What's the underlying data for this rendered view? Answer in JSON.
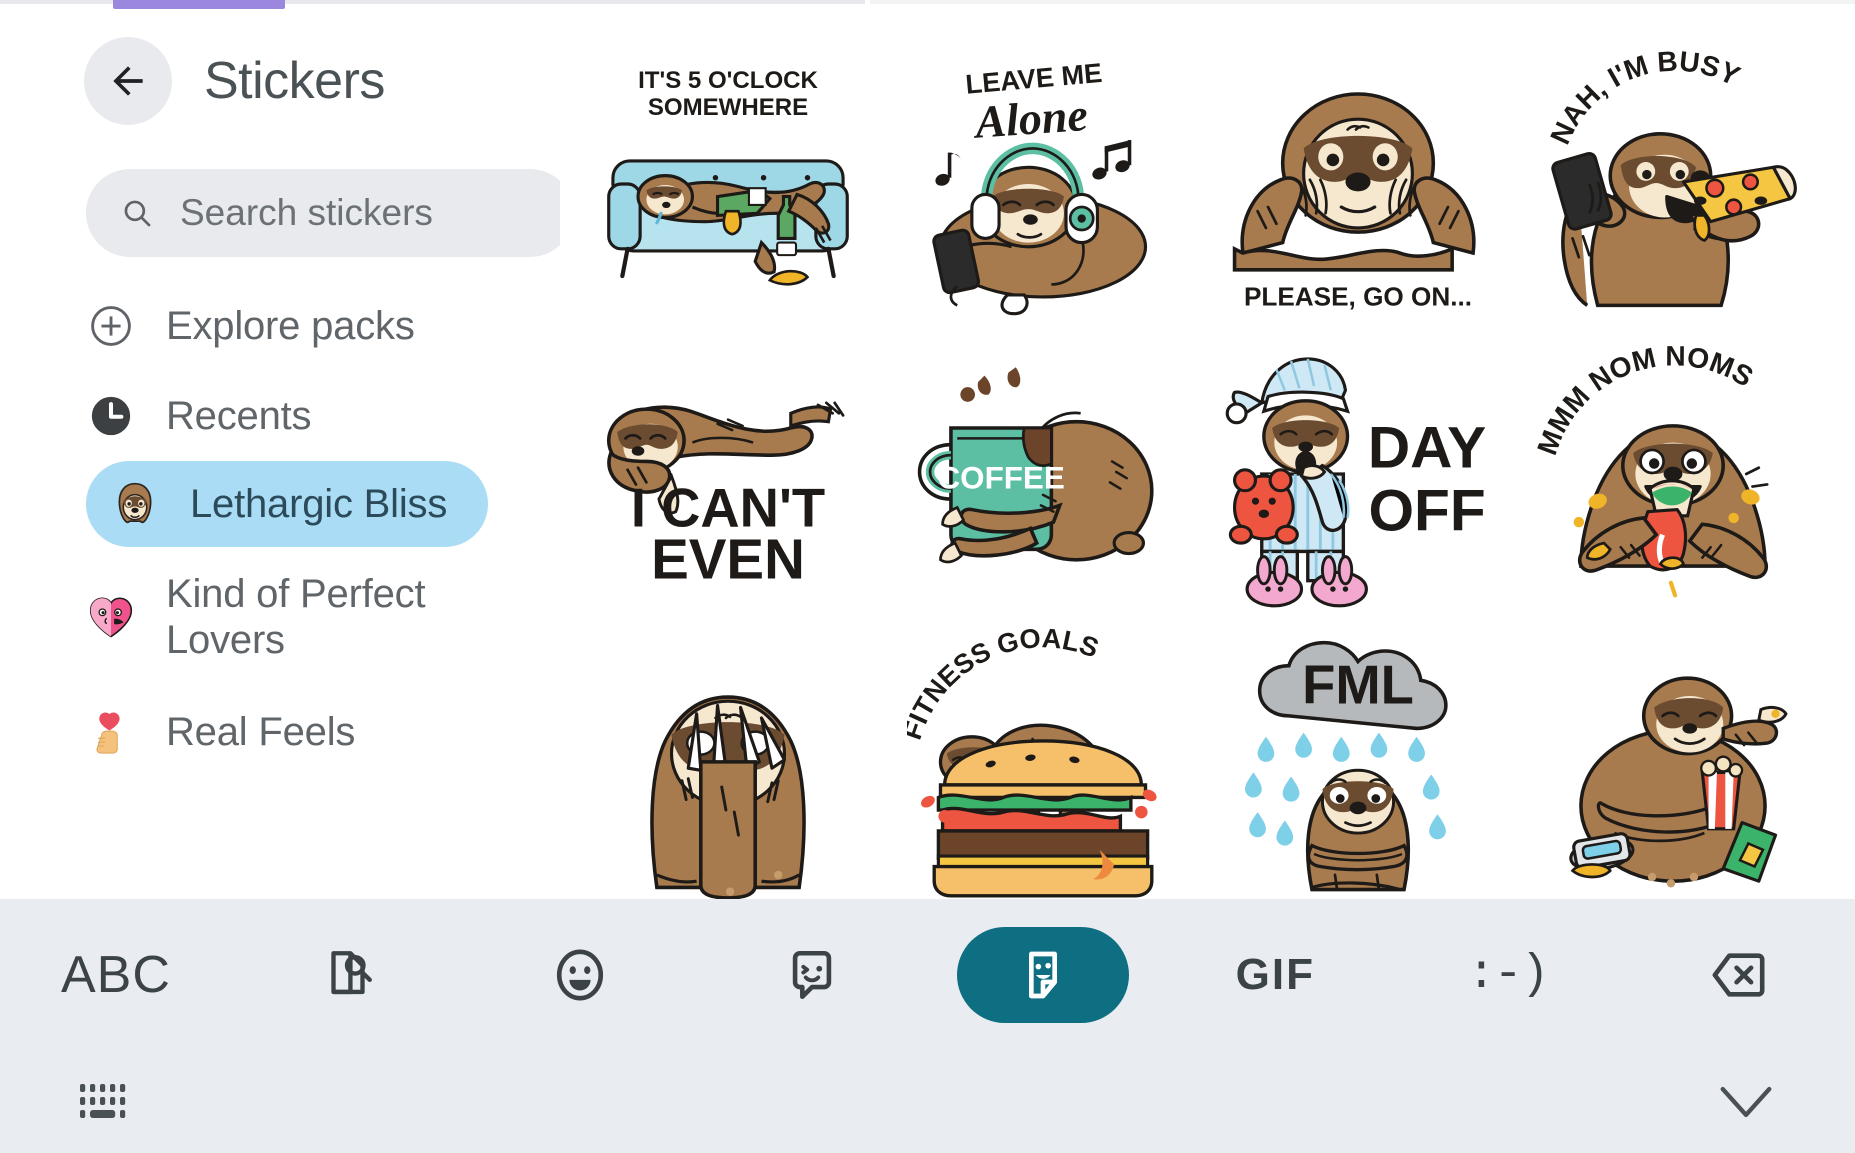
{
  "header": {
    "title": "Stickers",
    "back_icon": "arrow-left-icon"
  },
  "search": {
    "placeholder": "Search stickers",
    "value": "",
    "icon": "search-icon"
  },
  "sidebar": {
    "items": [
      {
        "label": "Explore packs",
        "icon": "plus-circle-icon",
        "selected": false
      },
      {
        "label": "Recents",
        "icon": "clock-icon",
        "selected": false
      },
      {
        "label": "Lethargic Bliss",
        "icon": "sloth-face-icon",
        "selected": true
      },
      {
        "label": "Kind of Perfect Lovers",
        "icon": "kissing-heart-icon",
        "selected": false
      },
      {
        "label": "Real Feels",
        "icon": "hand-holding-heart-icon",
        "selected": false
      }
    ],
    "selected_bg": "#aadcf5",
    "selected_text_color": "#2b4a5a"
  },
  "stickers": {
    "pack": "Lethargic Bliss",
    "items": [
      {
        "id": "five-oclock",
        "caption": "IT'S 5 O'CLOCK SOMEWHERE",
        "caption_line1": "IT'S 5 O'CLOCK",
        "caption_line2": "SOMEWHERE",
        "art": "sloth-on-couch-with-bottle"
      },
      {
        "id": "leave-me-alone",
        "caption": "LEAVE ME Alone",
        "caption_line1": "LEAVE ME",
        "caption_line2": "Alone",
        "art": "sloth-headphones-phone"
      },
      {
        "id": "please-go-on",
        "caption": "PLEASE, GO ON...",
        "caption_line1": "PLEASE, GO ON...",
        "caption_line2": "",
        "art": "sloth-hands-on-face"
      },
      {
        "id": "nah-im-busy",
        "caption": "NAH, I'M BUSY",
        "caption_line1": "NAH, I'M BUSY",
        "caption_line2": "",
        "art": "sloth-phone-pizza"
      },
      {
        "id": "i-cant-even",
        "caption": "I CAN'T EVEN",
        "caption_line1": "I CAN'T",
        "caption_line2": "EVEN",
        "art": "sloth-draped-flat"
      },
      {
        "id": "coffee",
        "caption": "COFFEE",
        "caption_line1": "COFFEE",
        "caption_line2": "",
        "art": "sloth-hugging-coffee-mug"
      },
      {
        "id": "day-off",
        "caption": "DAY OFF",
        "caption_line1": "DAY",
        "caption_line2": "OFF",
        "art": "sloth-pajamas-teddy-bunny-slippers"
      },
      {
        "id": "mmm-nom-noms",
        "caption": "MMM NOM NOMS",
        "caption_line1": "MMM NOM NOMS",
        "caption_line2": "",
        "art": "sloth-eating-taco"
      },
      {
        "id": "hanging-claws",
        "caption": "",
        "caption_line1": "",
        "caption_line2": "",
        "art": "sloth-hanging-claws-over-face"
      },
      {
        "id": "fitness-goals",
        "caption": "FITNESS GOALS",
        "caption_line1": "FITNESS GOALS",
        "caption_line2": "",
        "art": "sloth-on-burger"
      },
      {
        "id": "fml",
        "caption": "FML",
        "caption_line1": "FML",
        "caption_line2": "",
        "art": "sloth-under-rain-cloud"
      },
      {
        "id": "junk-food",
        "caption": "",
        "caption_line1": "",
        "caption_line2": "",
        "art": "sloth-with-snacks-and-soda"
      }
    ]
  },
  "keyboard_toolbar": {
    "active": "sticker-tab",
    "active_color": "#0e6e82",
    "items": [
      {
        "id": "abc",
        "label": "ABC",
        "icon": "abc-text-icon",
        "active": false
      },
      {
        "id": "text-search",
        "label": "",
        "icon": "document-search-icon",
        "active": false
      },
      {
        "id": "emoji",
        "label": "",
        "icon": "emoji-face-icon",
        "active": false
      },
      {
        "id": "emoji-sticker",
        "label": "",
        "icon": "sticker-bubble-icon",
        "active": false
      },
      {
        "id": "sticker-tab",
        "label": "",
        "icon": "sticker-card-icon",
        "active": true
      },
      {
        "id": "gif",
        "label": "GIF",
        "icon": "gif-text-icon",
        "active": false
      },
      {
        "id": "emoticon",
        "label": ":-)",
        "icon": "emoticon-text-icon",
        "active": false
      },
      {
        "id": "backspace",
        "label": "",
        "icon": "backspace-icon",
        "active": false
      }
    ]
  },
  "bottom_bar": {
    "left_icon": "keyboard-icon",
    "right_icon": "chevron-down-icon"
  }
}
